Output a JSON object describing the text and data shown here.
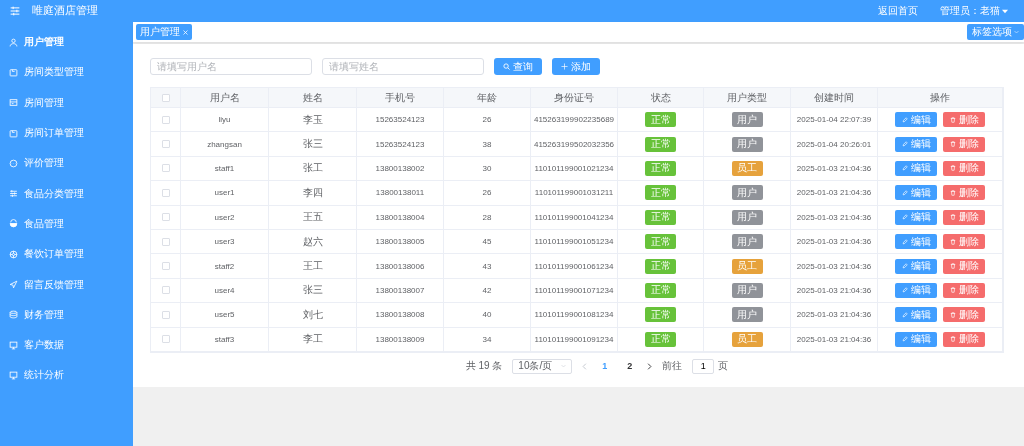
{
  "app_title": "唯庭酒店管理",
  "sidebar": {
    "items": [
      {
        "label": "用户管理",
        "selected": true
      },
      {
        "label": "房间类型管理",
        "selected": false
      },
      {
        "label": "房间管理",
        "selected": false
      },
      {
        "label": "房间订单管理",
        "selected": false
      },
      {
        "label": "评价管理",
        "selected": false
      },
      {
        "label": "食品分类管理",
        "selected": false
      },
      {
        "label": "食品管理",
        "selected": false
      },
      {
        "label": "餐饮订单管理",
        "selected": false
      },
      {
        "label": "留言反馈管理",
        "selected": false
      },
      {
        "label": "财务管理",
        "selected": false
      },
      {
        "label": "客户数据",
        "selected": false
      },
      {
        "label": "统计分析",
        "selected": false
      }
    ]
  },
  "header": {
    "home_link": "返回首页",
    "admin_menu": "管理员：老猫"
  },
  "tabs": [
    {
      "label": "用户管理",
      "selected": true
    }
  ],
  "tab_options": "标签选项",
  "filters": {
    "username": {
      "placeholder": "请填写用户名"
    },
    "name": {
      "placeholder": "请填写姓名"
    },
    "search_button": "查询",
    "add_button": "添加"
  },
  "table": {
    "header_checked": false,
    "columns": [
      "用户名",
      "姓名",
      "手机号",
      "年龄",
      "身份证号",
      "状态",
      "用户类型",
      "创建时间",
      "操作"
    ],
    "rows": [
      {
        "checked": false,
        "username": "liyu",
        "name": "李玉",
        "phone": "15263524123",
        "age": "26",
        "id_number": "415263199902235689",
        "status": "正常",
        "user_type": {
          "label": "用户",
          "kind": "user"
        },
        "created": "2025-01-04 22:07:39",
        "edit": "编辑",
        "delete": "删除"
      },
      {
        "checked": false,
        "username": "zhangsan",
        "name": "张三",
        "phone": "15263524123",
        "age": "38",
        "id_number": "415263199502032356",
        "status": "正常",
        "user_type": {
          "label": "用户",
          "kind": "user"
        },
        "created": "2025-01-04 20:26:01",
        "edit": "编辑",
        "delete": "删除"
      },
      {
        "checked": false,
        "username": "staff1",
        "name": "张工",
        "phone": "13800138002",
        "age": "30",
        "id_number": "110101199001021234",
        "status": "正常",
        "user_type": {
          "label": "员工",
          "kind": "staff"
        },
        "created": "2025-01-03 21:04:36",
        "edit": "编辑",
        "delete": "删除"
      },
      {
        "checked": false,
        "username": "user1",
        "name": "李四",
        "phone": "13800138011",
        "age": "26",
        "id_number": "110101199001031211",
        "status": "正常",
        "user_type": {
          "label": "用户",
          "kind": "user"
        },
        "created": "2025-01-03 21:04:36",
        "edit": "编辑",
        "delete": "删除"
      },
      {
        "checked": false,
        "username": "user2",
        "name": "王五",
        "phone": "13800138004",
        "age": "28",
        "id_number": "110101199001041234",
        "status": "正常",
        "user_type": {
          "label": "用户",
          "kind": "user"
        },
        "created": "2025-01-03 21:04:36",
        "edit": "编辑",
        "delete": "删除"
      },
      {
        "checked": false,
        "username": "user3",
        "name": "赵六",
        "phone": "13800138005",
        "age": "45",
        "id_number": "110101199001051234",
        "status": "正常",
        "user_type": {
          "label": "用户",
          "kind": "user"
        },
        "created": "2025-01-03 21:04:36",
        "edit": "编辑",
        "delete": "删除"
      },
      {
        "checked": false,
        "username": "staff2",
        "name": "王工",
        "phone": "13800138006",
        "age": "43",
        "id_number": "110101199001061234",
        "status": "正常",
        "user_type": {
          "label": "员工",
          "kind": "staff"
        },
        "created": "2025-01-03 21:04:36",
        "edit": "编辑",
        "delete": "删除"
      },
      {
        "checked": false,
        "username": "user4",
        "name": "张三",
        "phone": "13800138007",
        "age": "42",
        "id_number": "110101199001071234",
        "status": "正常",
        "user_type": {
          "label": "用户",
          "kind": "user"
        },
        "created": "2025-01-03 21:04:36",
        "edit": "编辑",
        "delete": "删除"
      },
      {
        "checked": false,
        "username": "user5",
        "name": "刘七",
        "phone": "13800138008",
        "age": "40",
        "id_number": "110101199001081234",
        "status": "正常",
        "user_type": {
          "label": "用户",
          "kind": "user"
        },
        "created": "2025-01-03 21:04:36",
        "edit": "编辑",
        "delete": "删除"
      },
      {
        "checked": false,
        "username": "staff3",
        "name": "李工",
        "phone": "13800138009",
        "age": "34",
        "id_number": "110101199001091234",
        "status": "正常",
        "user_type": {
          "label": "员工",
          "kind": "staff"
        },
        "created": "2025-01-03 21:04:36",
        "edit": "编辑",
        "delete": "删除"
      }
    ]
  },
  "pagination": {
    "total": "共 19 条",
    "page_size": "10条/页",
    "pages": [
      {
        "label": "1",
        "selected": true
      },
      {
        "label": "2",
        "selected": false
      }
    ],
    "goto_label": "前往",
    "goto_value": "1",
    "goto_suffix": "页"
  }
}
